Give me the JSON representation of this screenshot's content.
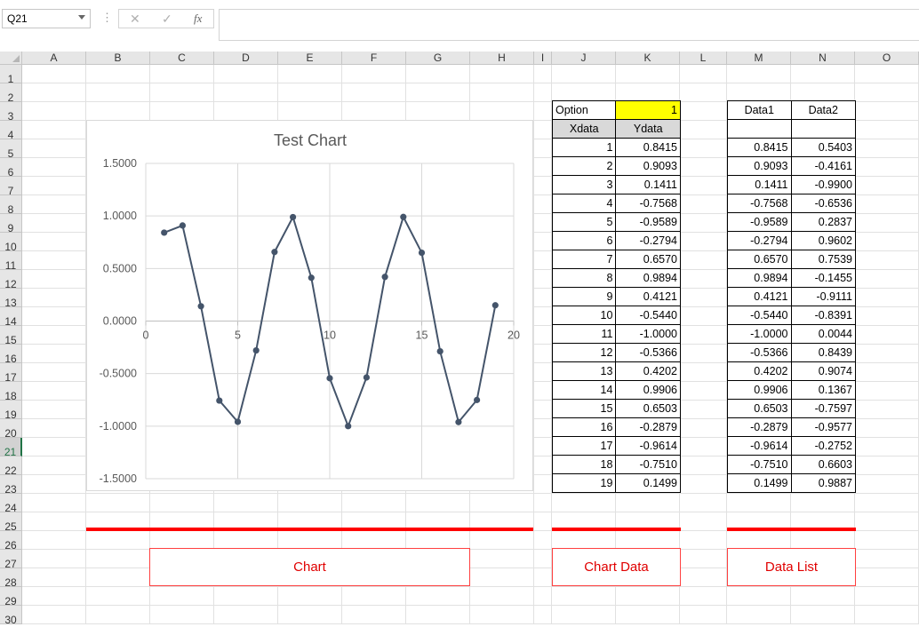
{
  "formula_bar": {
    "name_box": "Q21",
    "cancel_icon": "✕",
    "enter_icon": "✓",
    "fx_label": "fx",
    "formula": ""
  },
  "columns": [
    "A",
    "B",
    "C",
    "D",
    "E",
    "F",
    "G",
    "H",
    "I",
    "J",
    "K",
    "L",
    "M",
    "N",
    "O"
  ],
  "rows": [
    "1",
    "2",
    "3",
    "4",
    "5",
    "6",
    "7",
    "8",
    "9",
    "10",
    "11",
    "12",
    "13",
    "14",
    "15",
    "16",
    "17",
    "18",
    "19",
    "20",
    "21",
    "22",
    "23",
    "24",
    "25",
    "26",
    "27",
    "28",
    "29",
    "30"
  ],
  "selected_row": "21",
  "option_table": {
    "option_label": "Option",
    "option_value": "1",
    "xdata_header": "Xdata",
    "ydata_header": "Ydata",
    "highlight_color": "#ffff00",
    "header_fill": "#d9d9d9"
  },
  "list_table": {
    "data1_header": "Data1",
    "data2_header": "Data2"
  },
  "xdata": [
    1,
    2,
    3,
    4,
    5,
    6,
    7,
    8,
    9,
    10,
    11,
    12,
    13,
    14,
    15,
    16,
    17,
    18,
    19
  ],
  "ydata": [
    "0.8415",
    "0.9093",
    "0.1411",
    "-0.7568",
    "-0.9589",
    "-0.2794",
    "0.6570",
    "0.9894",
    "0.4121",
    "-0.5440",
    "-1.0000",
    "-0.5366",
    "0.4202",
    "0.9906",
    "0.6503",
    "-0.2879",
    "-0.9614",
    "-0.7510",
    "0.1499"
  ],
  "data1": [
    "0.8415",
    "0.9093",
    "0.1411",
    "-0.7568",
    "-0.9589",
    "-0.2794",
    "0.6570",
    "0.9894",
    "0.4121",
    "-0.5440",
    "-1.0000",
    "-0.5366",
    "0.4202",
    "0.9906",
    "0.6503",
    "-0.2879",
    "-0.9614",
    "-0.7510",
    "0.1499"
  ],
  "data2": [
    "0.5403",
    "-0.4161",
    "-0.9900",
    "-0.6536",
    "0.2837",
    "0.9602",
    "0.7539",
    "-0.1455",
    "-0.9111",
    "-0.8391",
    "0.0044",
    "0.8439",
    "0.9074",
    "0.1367",
    "-0.7597",
    "-0.9577",
    "-0.2752",
    "0.6603",
    "0.9887"
  ],
  "chart_data": {
    "type": "scatter",
    "title": "Test Chart",
    "series": [
      {
        "x": [
          1,
          2,
          3,
          4,
          5,
          6,
          7,
          8,
          9,
          10,
          11,
          12,
          13,
          14,
          15,
          16,
          17,
          18,
          19
        ],
        "y": [
          0.8415,
          0.9093,
          0.1411,
          -0.7568,
          -0.9589,
          -0.2794,
          0.657,
          0.9894,
          0.4121,
          -0.544,
          -1.0,
          -0.5366,
          0.4202,
          0.9906,
          0.6503,
          -0.2879,
          -0.9614,
          -0.751,
          0.1499
        ]
      }
    ],
    "xlim": [
      0,
      20
    ],
    "ylim": [
      -1.5,
      1.5
    ],
    "xticks": [
      "0",
      "5",
      "10",
      "15",
      "20"
    ],
    "yticks": [
      "1.5000",
      "1.0000",
      "0.5000",
      "0.0000",
      "-0.5000",
      "-1.0000",
      "-1.5000"
    ],
    "line_color": "#44546a",
    "grid": true
  },
  "buttons": {
    "chart": "Chart",
    "chart_data": "Chart Data",
    "data_list": "Data List"
  },
  "accent_color": "#ff0000"
}
